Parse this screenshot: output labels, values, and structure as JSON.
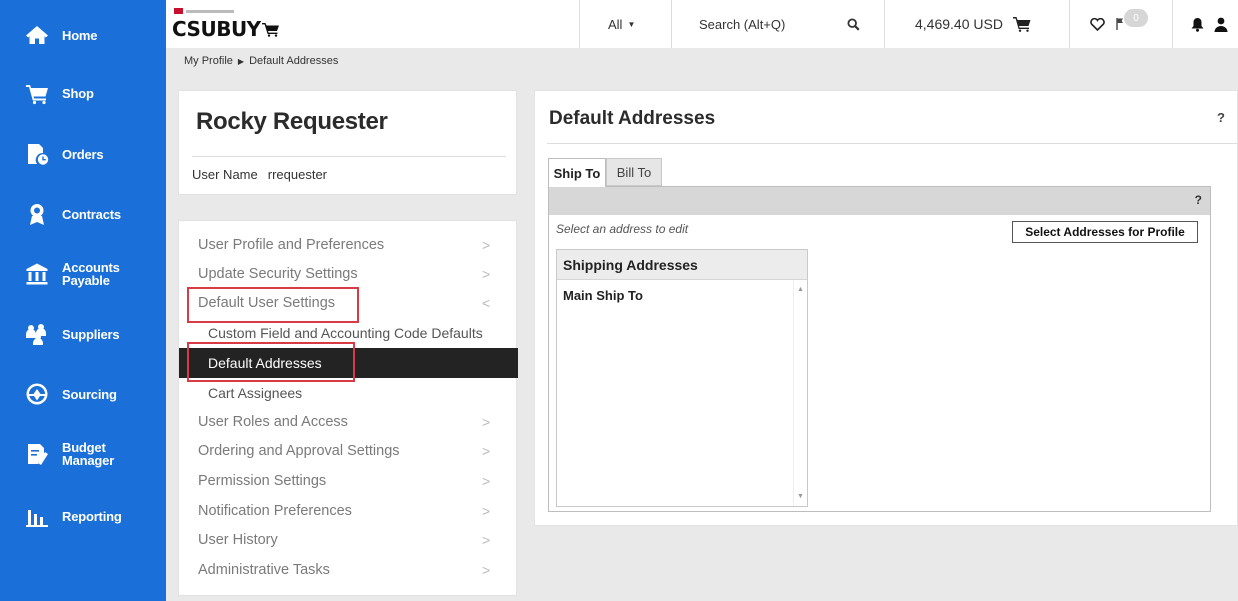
{
  "nav": {
    "items": [
      {
        "label": "Home",
        "icon": "home-icon"
      },
      {
        "label": "Shop",
        "icon": "shop-cart-icon"
      },
      {
        "label": "Orders",
        "icon": "orders-icon"
      },
      {
        "label": "Contracts",
        "icon": "contracts-icon"
      },
      {
        "label1": "Accounts",
        "label2": "Payable",
        "icon": "bank-icon"
      },
      {
        "label": "Suppliers",
        "icon": "suppliers-icon"
      },
      {
        "label": "Sourcing",
        "icon": "sourcing-icon"
      },
      {
        "label1": "Budget",
        "label2": "Manager",
        "icon": "budget-icon"
      },
      {
        "label": "Reporting",
        "icon": "reporting-icon"
      }
    ]
  },
  "header": {
    "logo_text": "CSUBUY",
    "scope_label": "All",
    "search_placeholder": "Search (Alt+Q)",
    "cart_amount": "4,469.40 USD",
    "flag_count": "0"
  },
  "breadcrumb": {
    "parent": "My Profile",
    "current": "Default Addresses"
  },
  "profile": {
    "name": "Rocky Requester",
    "username_label": "User Name",
    "username_value": "rrequester"
  },
  "menu": {
    "items": [
      {
        "label": "User Profile and Preferences",
        "chev": ">"
      },
      {
        "label": "Update Security Settings",
        "chev": ">"
      },
      {
        "label": "Default User Settings",
        "chev": "<"
      },
      {
        "label": "Custom Field and Accounting Code Defaults"
      },
      {
        "label": "Default Addresses"
      },
      {
        "label": "Cart Assignees"
      },
      {
        "label": "User Roles and Access",
        "chev": ">"
      },
      {
        "label": "Ordering and Approval Settings",
        "chev": ">"
      },
      {
        "label": "Permission Settings",
        "chev": ">"
      },
      {
        "label": "Notification Preferences",
        "chev": ">"
      },
      {
        "label": "User History",
        "chev": ">"
      },
      {
        "label": "Administrative Tasks",
        "chev": ">"
      }
    ]
  },
  "main": {
    "title": "Default Addresses",
    "help": "?",
    "tabs": [
      "Ship To",
      "Bill To"
    ],
    "panel_help": "?",
    "select_hint": "Select an address to edit",
    "select_button": "Select Addresses for Profile",
    "list_header": "Shipping Addresses",
    "addresses": [
      "Main Ship To"
    ]
  },
  "colors": {
    "nav_bg": "#1a6fd8",
    "active_menu_bg": "#232323",
    "highlight_box": "#d83a46"
  }
}
